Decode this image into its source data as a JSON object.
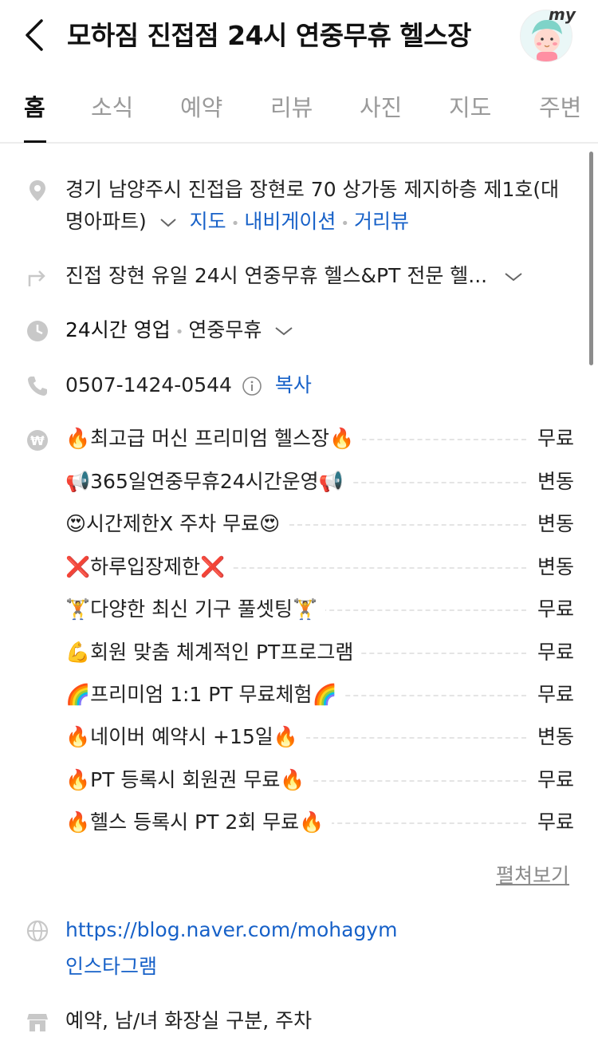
{
  "header": {
    "title": "모하짐 진접점 24시 연중무휴 헬스장",
    "avatar_label": "my"
  },
  "tabs": [
    {
      "label": "홈",
      "active": true
    },
    {
      "label": "소식"
    },
    {
      "label": "예약"
    },
    {
      "label": "리뷰"
    },
    {
      "label": "사진"
    },
    {
      "label": "지도"
    },
    {
      "label": "주변"
    }
  ],
  "address": {
    "line1": "경기 남양주시 진접읍 장현로 70 상가동 제지하층 제1호(대",
    "line2": "명아파트)",
    "map_link": "지도",
    "navi_link": "내비게이션",
    "street_link": "거리뷰"
  },
  "directions": {
    "text": "진접 장현 유일 24시 연중무휴 헬스&PT 전문 헬..."
  },
  "hours": {
    "status": "24시간 영업",
    "note": "연중무휴"
  },
  "phone": {
    "number": "0507-1424-0544",
    "copy_label": "복사"
  },
  "prices": [
    {
      "name": "🔥최고급 머신 프리미엄 헬스장🔥",
      "value": "무료"
    },
    {
      "name": "📢365일연중무휴24시간운영📢",
      "value": "변동"
    },
    {
      "name": "😍시간제한X 주차 무료😍",
      "value": "변동"
    },
    {
      "name": "❌하루입장제한❌",
      "value": "변동"
    },
    {
      "name": "🏋️다양한 최신 기구 풀셋팅🏋️",
      "value": "무료"
    },
    {
      "name": "💪회원 맞춤 체계적인 PT프로그램",
      "value": "무료"
    },
    {
      "name": "🌈프리미엄 1:1 PT 무료체험🌈",
      "value": "무료"
    },
    {
      "name": "🔥네이버 예약시 +15일🔥",
      "value": "변동"
    },
    {
      "name": "🔥PT 등록시 회원권 무료🔥",
      "value": "무료"
    },
    {
      "name": "🔥헬스 등록시 PT 2회 무료🔥",
      "value": "무료"
    }
  ],
  "expand_label": "펼쳐보기",
  "links": {
    "blog": "https://blog.naver.com/mohagym",
    "instagram": "인스타그램"
  },
  "facilities": "예약, 남/녀 화장실 구분, 주차",
  "colors": {
    "link": "#1761c8",
    "icon": "#c8c8c8"
  }
}
